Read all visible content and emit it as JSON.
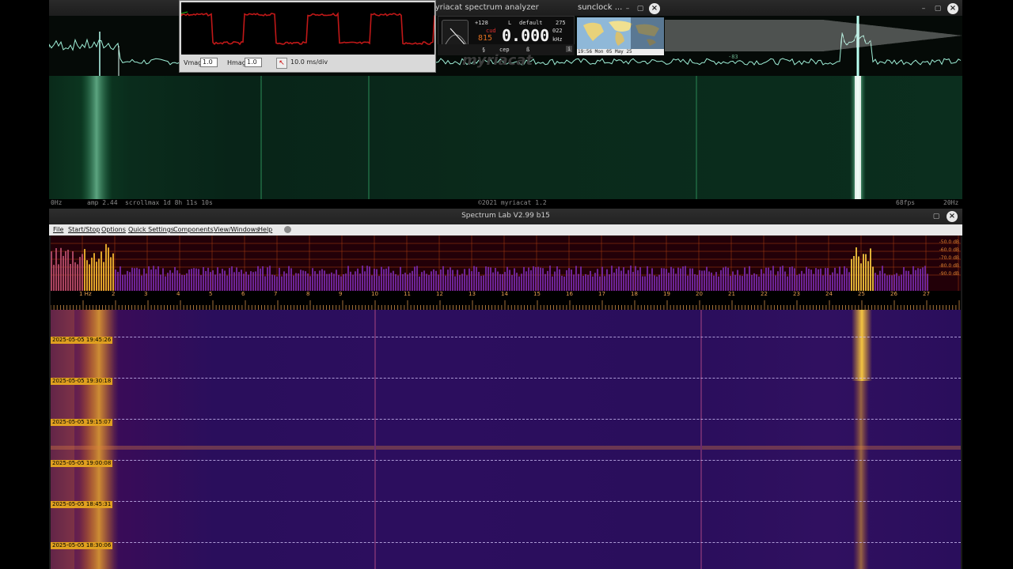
{
  "myriacat": {
    "title": "myriacat spectrum analyzer",
    "status": {
      "left_freq": "0Hz",
      "amp": "amp 2.44",
      "scroll": "scrollmax 1d 8h 11s 10s",
      "copyright": "©2021 myriacat 1.2",
      "fps": "68fps",
      "right_freq": "20Hz"
    },
    "spectrum_marker": "-83",
    "scope": {
      "vmag_label": "Vmag",
      "vmag_value": "1.0",
      "hmag_label": "Hmag",
      "hmag_value": "1.0",
      "timebase": "10.0 ms/div"
    },
    "radio": {
      "level": "+128",
      "mode_l": "L",
      "preset": "default",
      "count": "275",
      "frequency": "0.000",
      "unit_top": "022",
      "unit": "kHz",
      "cud": "cud",
      "small_digits": "815",
      "btn1": "§",
      "btn2": "cep",
      "btn3": "ß",
      "info": "i"
    },
    "logo": "myriacat"
  },
  "sunclock": {
    "title": "sunclock ...",
    "date": "19:56 Mon 05 May 25"
  },
  "spectrum_lab": {
    "title": "Spectrum Lab V2.99 b15",
    "menu": [
      "File",
      "Start/Stop",
      "Options",
      "Quick Settings",
      "Components",
      "View/Windows",
      "Help"
    ],
    "db_labels": [
      "-50.0 dB",
      "-60.0 dB",
      "-70.0 dB",
      "-80.0 dB",
      "-90.0 dB"
    ],
    "freq_labels": [
      "1 Hz",
      "2",
      "3",
      "4",
      "5",
      "6",
      "7",
      "8",
      "9",
      "10",
      "11",
      "12",
      "13",
      "14",
      "15",
      "16",
      "17",
      "18",
      "19",
      "20",
      "21",
      "22",
      "23",
      "24",
      "25",
      "26",
      "27"
    ],
    "timestamps": [
      "2025-05-05 19:45:26",
      "2025-05-05 19:30:18",
      "2025-05-05 19:15:07",
      "2025-05-05 19:00:08",
      "2025-05-05 18:45:31",
      "2025-05-05 18:30:06"
    ]
  },
  "colors": {
    "myriacat_accent": "#7fffd0",
    "spectrum_lab_hot": "#ffd040",
    "timestamp_bg": "#e0a020"
  }
}
